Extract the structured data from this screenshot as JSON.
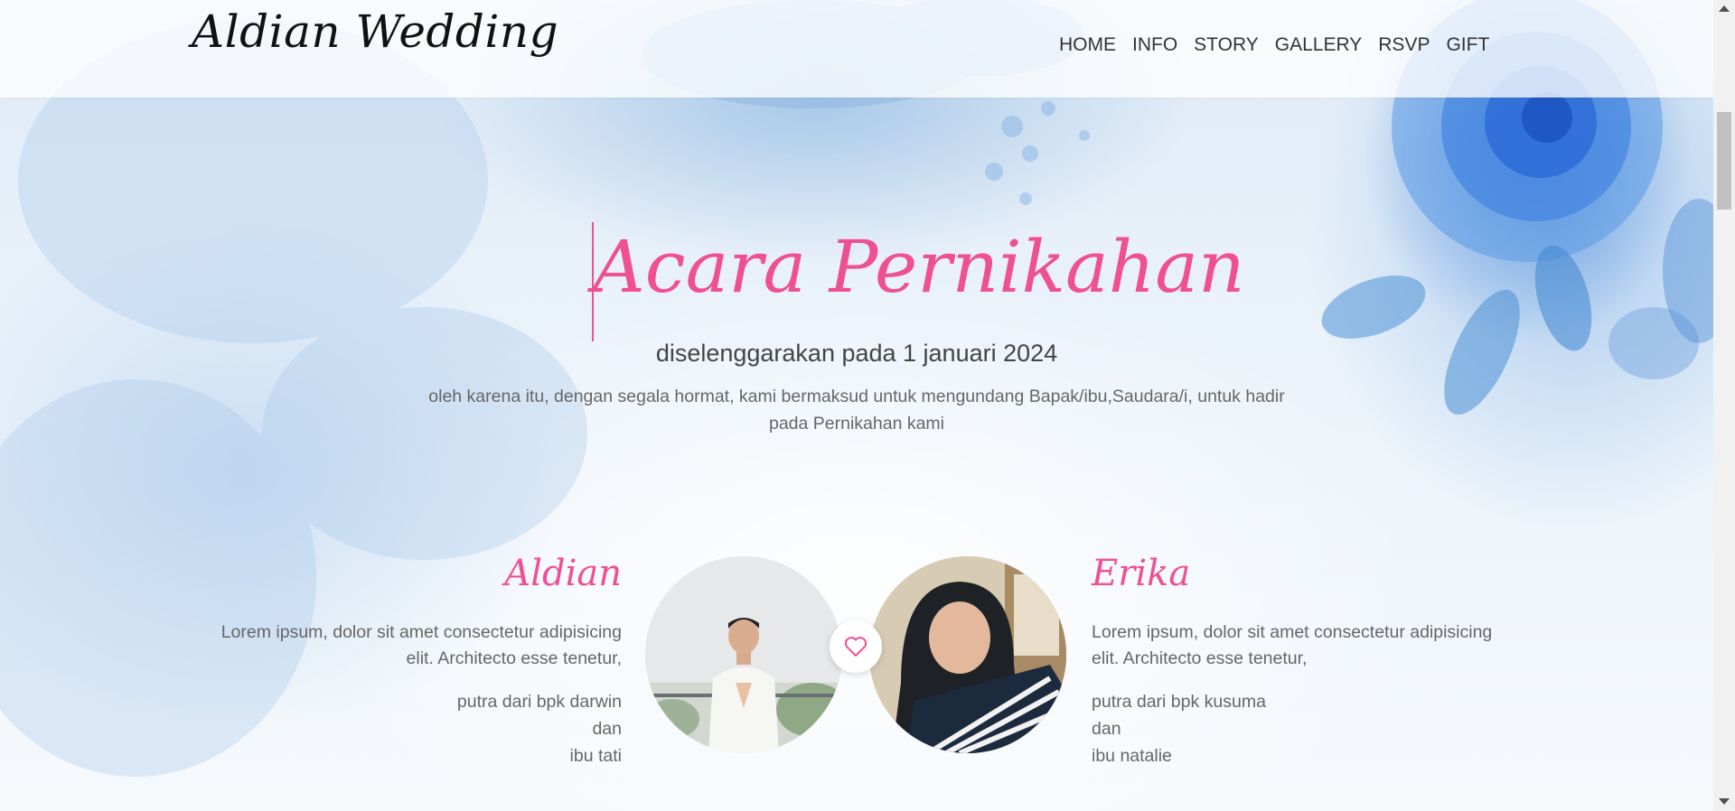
{
  "brand": "Aldian Wedding",
  "nav": [
    "HOME",
    "INFO",
    "STORY",
    "GALLERY",
    "RSVP",
    "GIFT"
  ],
  "hero": {
    "title": "Acara Pernikahan",
    "subtitle": "diselenggarakan pada 1 januari 2024",
    "text": "oleh karena itu, dengan segala hormat, kami bermaksud untuk mengundang Bapak/ibu,Saudara/i, untuk hadir pada Pernikahan kami"
  },
  "groom": {
    "name": "Aldian",
    "bio": "Lorem ipsum, dolor sit amet consectetur adipisicing elit. Architecto esse tenetur,",
    "parents": [
      "putra dari bpk darwin",
      "dan",
      "ibu tati"
    ]
  },
  "bride": {
    "name": "Erika",
    "bio": "Lorem ipsum, dolor sit amet consectetur adipisicing elit. Architecto esse tenetur,",
    "parents": [
      "putra dari bpk kusuma",
      "dan",
      "ibu natalie"
    ]
  },
  "colors": {
    "accent": "#ef4f93",
    "text": "#666666",
    "nav_text": "#333333"
  },
  "icons": {
    "center": "heart-icon"
  }
}
